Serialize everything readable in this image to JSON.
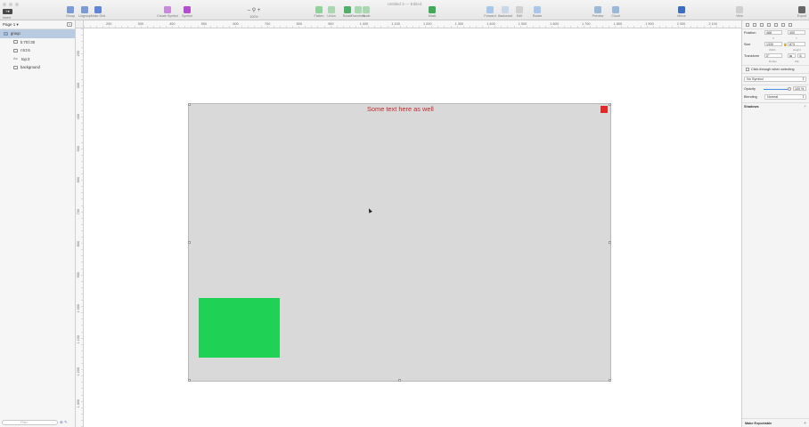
{
  "window": {
    "title": "Untitled 3 — Edited"
  },
  "toolbar": {
    "insert_label": "Insert",
    "buttons": [
      {
        "name": "group",
        "label": "Group",
        "color": "#7a9bd8"
      },
      {
        "name": "ungroup",
        "label": "Ungroup",
        "color": "#7a9bd8"
      },
      {
        "name": "make-grid",
        "label": "Make Grid",
        "color": "#5e85d6"
      },
      {
        "name": "create-symbol",
        "label": "Create Symbol",
        "color": "#c98ad8"
      },
      {
        "name": "symbol",
        "label": "Symbol",
        "color": "#b44dd0"
      },
      {
        "name": "zoom",
        "label": "100%"
      },
      {
        "name": "flatten",
        "label": "Flatten",
        "color": "#8fd39a"
      },
      {
        "name": "union",
        "label": "Union",
        "color": "#a8d8b0"
      },
      {
        "name": "rotate",
        "label": "Rotate",
        "color": "#4fb06a"
      },
      {
        "name": "transform",
        "label": "Transform",
        "color": "#a8d8b0"
      },
      {
        "name": "scale",
        "label": "Scale",
        "color": "#a8d8b0"
      },
      {
        "name": "mask",
        "label": "Mask",
        "color": "#3faa5a"
      },
      {
        "name": "forward",
        "label": "Forward",
        "color": "#a8c8ea"
      },
      {
        "name": "backward",
        "label": "Backward",
        "color": "#c8d8ea"
      },
      {
        "name": "edit",
        "label": "Edit",
        "color": "#d0d0d0"
      },
      {
        "name": "rotate-copies",
        "label": "Rotate",
        "color": "#a8c8ea"
      },
      {
        "name": "preview",
        "label": "Preview",
        "color": "#9ab8d8"
      },
      {
        "name": "cloud",
        "label": "Cloud",
        "color": "#9ab8d8"
      },
      {
        "name": "mirror",
        "label": "Mirror",
        "color": "#3a6ec2"
      },
      {
        "name": "view",
        "label": "View",
        "color": "#cfcfcf"
      },
      {
        "name": "export",
        "label": "Export",
        "color": "#666666"
      }
    ],
    "zoom_icon": "zoom-icon",
    "zoom_minus": "–",
    "zoom_plus": "+"
  },
  "sidebar": {
    "page_label": "Page 1 ▾",
    "layers": [
      {
        "label": "group",
        "type": "folder",
        "selected": true
      },
      {
        "label": "b:70:l:30",
        "type": "rect"
      },
      {
        "label": "r:6:t:6",
        "type": "rect"
      },
      {
        "label": "top:3",
        "type": "text"
      },
      {
        "label": "background",
        "type": "rect"
      }
    ],
    "filter_placeholder": "Filter"
  },
  "rulers": {
    "x_ticks": [
      "200",
      "300",
      "400",
      "500",
      "600",
      "700",
      "800",
      "900",
      "1 000",
      "1 100",
      "1 200",
      "1 300",
      "1 400",
      "1 500",
      "1 600",
      "1 700",
      "1 800",
      "1 900",
      "2 000",
      "2 100"
    ],
    "y_ticks": [
      "200",
      "300",
      "400",
      "500",
      "600",
      "700",
      "800",
      "900",
      "1 000",
      "1 100",
      "1 200",
      "1 300"
    ]
  },
  "canvas": {
    "text": "Some text here as well",
    "text_color": "#c0282e",
    "background_color": "#d9d9d9",
    "red_color": "#e02a2a",
    "green_color": "#1fd255"
  },
  "inspector": {
    "position_label": "Position",
    "position_x": "468",
    "position_y": "400",
    "x_label": "X",
    "y_label": "Y",
    "size_label": "Size",
    "width": "1330",
    "height": "873",
    "width_label": "Width",
    "height_label": "Height",
    "transform_label": "Transform",
    "rotate_value": "0°",
    "rotate_label": "Rotate",
    "flip_label": "Flip",
    "click_through_label": "Click-through when selecting",
    "symbol_select": "No Symbol",
    "opacity_label": "Opacity",
    "opacity_value": "100 %",
    "opacity_fraction": 1.0,
    "blending_label": "Blending",
    "blending_value": "Normal",
    "shadows_label": "Shadows",
    "make_exportable_label": "Make Exportable"
  }
}
